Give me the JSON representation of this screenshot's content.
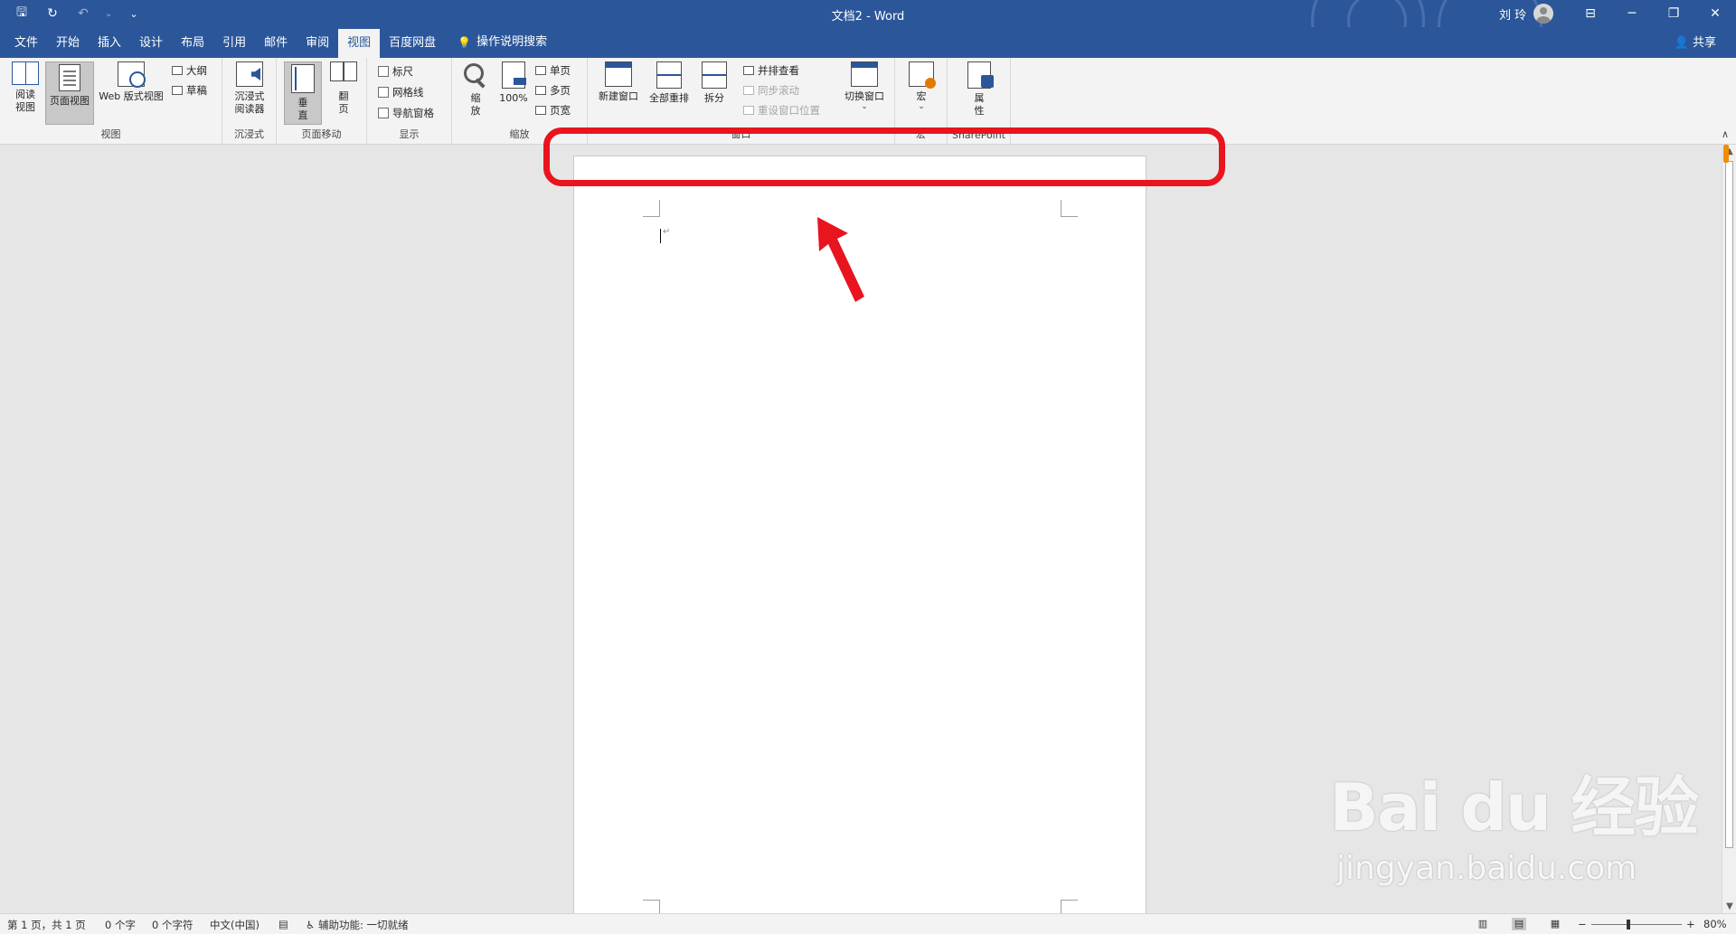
{
  "titlebar": {
    "title": "文档2 - Word",
    "user": "刘 玲",
    "qat": {
      "save": "🖫",
      "redo": "↻",
      "undo": "↶",
      "undo_dd": "⌄",
      "customize": "⌄"
    },
    "controls": {
      "ribbon_display": "⊟",
      "minimize": "─",
      "restore": "❐",
      "close": "✕"
    }
  },
  "tabs": [
    "文件",
    "开始",
    "插入",
    "设计",
    "布局",
    "引用",
    "邮件",
    "审阅",
    "视图",
    "百度网盘"
  ],
  "active_tab": "视图",
  "tellme": {
    "icon": "💡",
    "label": "操作说明搜索"
  },
  "share": "共享",
  "ribbon": {
    "views": {
      "read_mode": [
        "阅读",
        "视图"
      ],
      "print_layout": "页面视图",
      "web_layout": "Web 版式视图",
      "outline": "大纲",
      "draft": "草稿",
      "label": "视图"
    },
    "immersive": {
      "reader": [
        "沉浸式",
        "阅读器"
      ],
      "label": "沉浸式"
    },
    "page_movement": {
      "vertical": [
        "垂",
        "直"
      ],
      "side": [
        "翻",
        "页"
      ],
      "label": "页面移动"
    },
    "show": {
      "ruler": "标尺",
      "gridlines": "网格线",
      "nav_pane": "导航窗格",
      "label": "显示"
    },
    "zoom": {
      "zoom": [
        "缩",
        "放"
      ],
      "hundred": "100%",
      "one_page": "单页",
      "multi_page": "多页",
      "page_width": "页宽",
      "label": "缩放"
    },
    "window": {
      "new_window": "新建窗口",
      "arrange_all": "全部重排",
      "split": "拆分",
      "side_by_side": "并排查看",
      "sync_scroll": "同步滚动",
      "reset_position": "重设窗口位置",
      "switch": "切换窗口",
      "label": "窗口"
    },
    "macros": {
      "macro": "宏",
      "label": "宏"
    },
    "sharepoint": {
      "properties": [
        "属",
        "性"
      ],
      "label": "SharePoint"
    }
  },
  "document": {
    "para_mark": "↵"
  },
  "statusbar": {
    "page": "第 1 页，共 1 页",
    "words": "0 个字",
    "chars": "0 个字符",
    "language": "中文(中国)",
    "accessibility": "辅助功能: 一切就绪",
    "zoom_minus": "−",
    "zoom_plus": "+",
    "zoom_level": "80%"
  },
  "watermark": {
    "logo": "Bai du 经验",
    "url": "jingyan.baidu.com"
  },
  "colors": {
    "word_blue": "#2b579a",
    "annotation_red": "#e8141e"
  }
}
